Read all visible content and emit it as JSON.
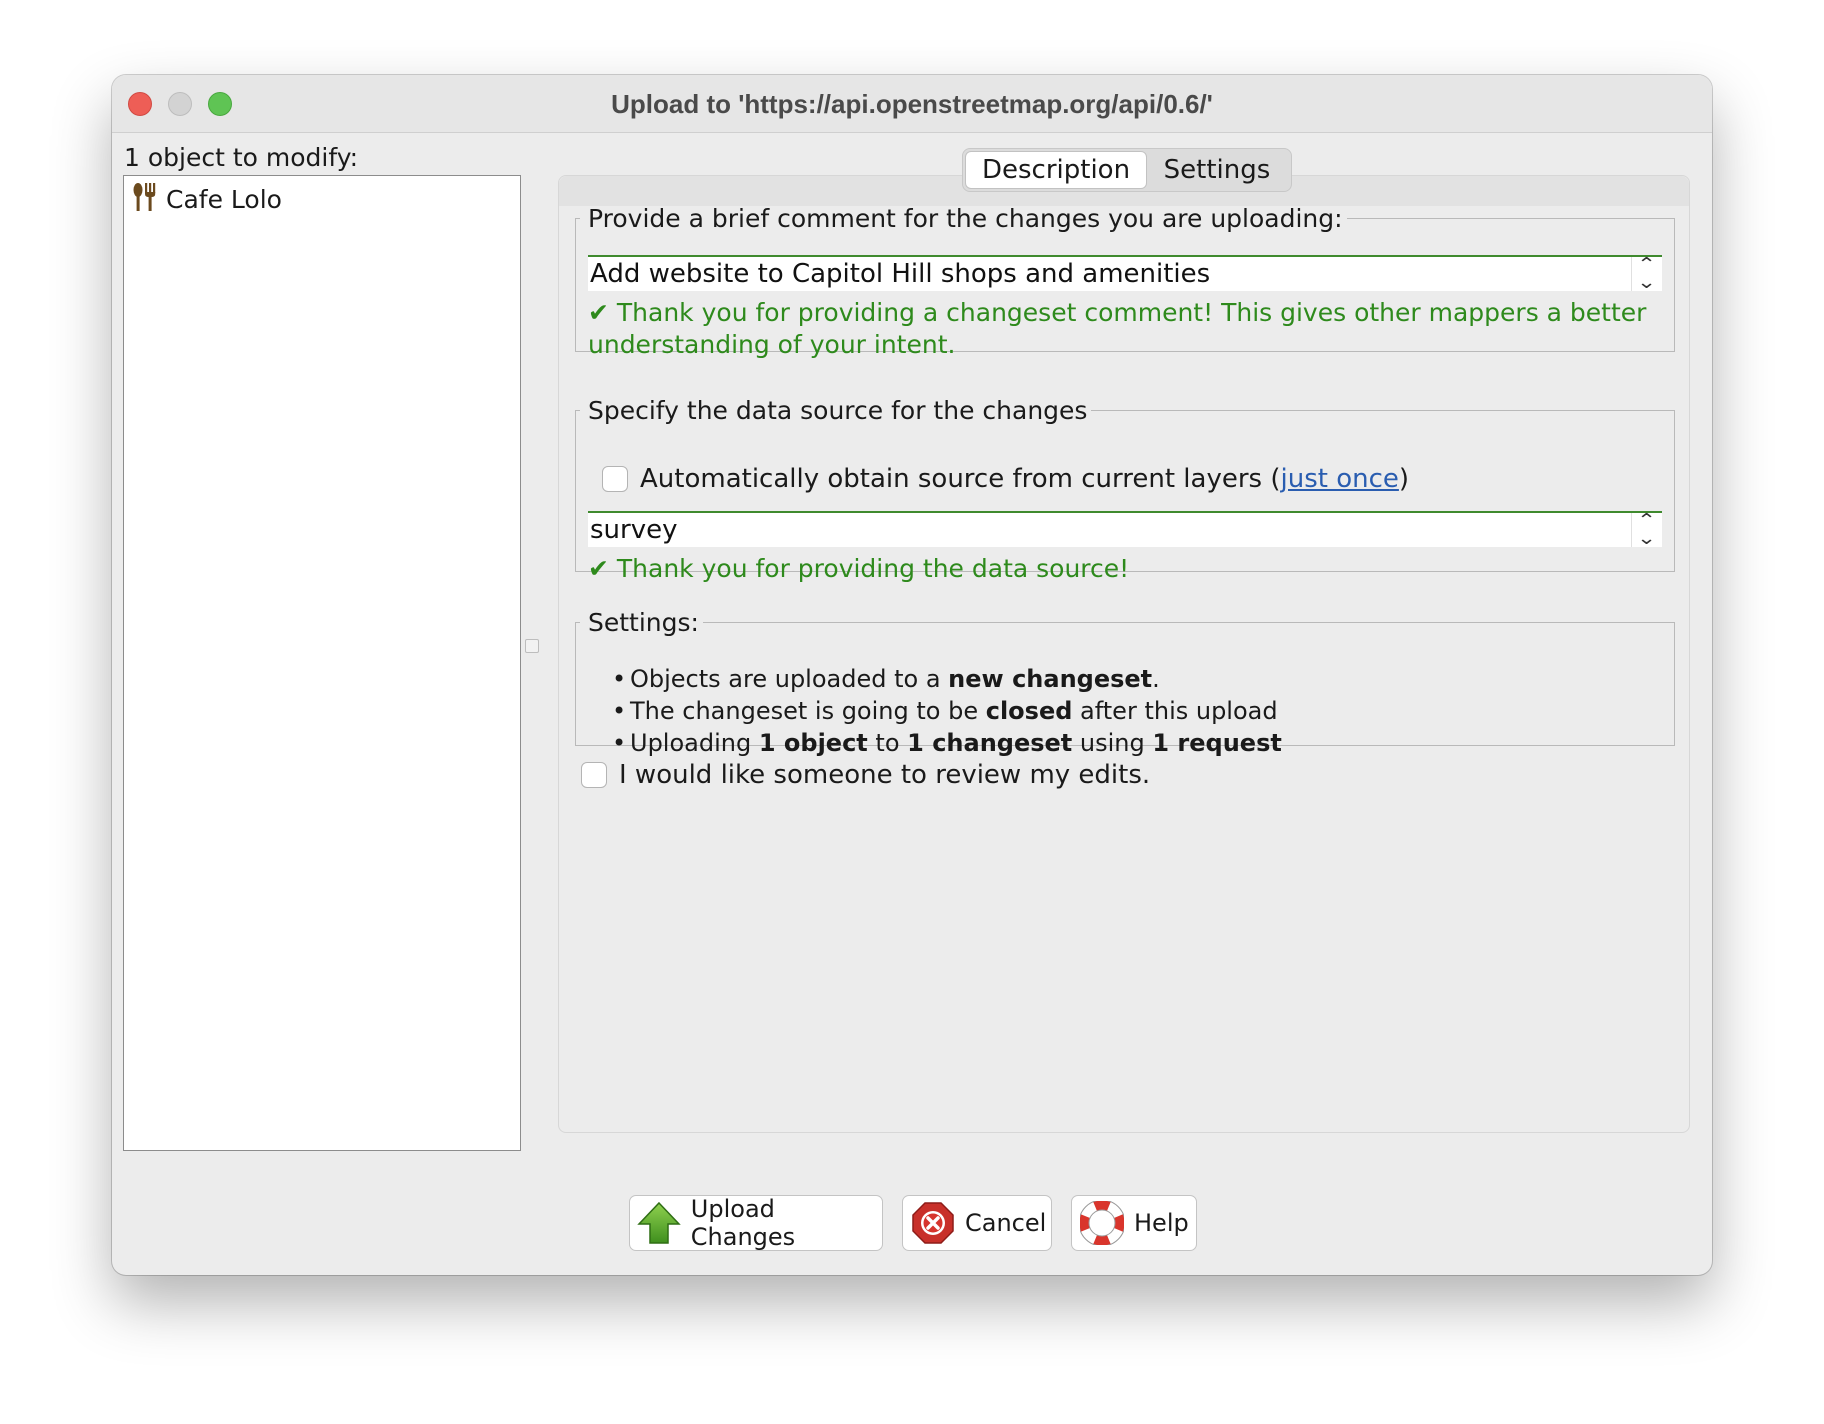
{
  "window": {
    "title": "Upload to 'https://api.openstreetmap.org/api/0.6/'"
  },
  "left_panel": {
    "header": "1 object to modify:",
    "objects": [
      {
        "label": "Cafe Lolo",
        "icon": "restaurant-icon"
      }
    ]
  },
  "tabs": [
    {
      "label": "Description",
      "active": true
    },
    {
      "label": "Settings",
      "active": false
    }
  ],
  "comment_group": {
    "legend": "Provide a brief comment for the changes you are uploading:",
    "value": "Add website to Capitol Hill shops and amenities",
    "ok_message": "✔ Thank you for providing a changeset comment! This gives other mappers a better understanding of your intent."
  },
  "source_group": {
    "legend": "Specify the data source for the changes",
    "auto_label": "Automatically obtain source from current layers",
    "auto_checked": false,
    "paren_open": "(",
    "just_once_link": "just once",
    "paren_close": ")",
    "value": "survey",
    "ok_message": "✔ Thank you for providing the data source!"
  },
  "settings_group": {
    "legend": "Settings:",
    "lines": [
      [
        "Objects are uploaded to a ",
        "new changeset",
        "."
      ],
      [
        "The changeset is going to be ",
        "closed",
        " after this upload"
      ],
      [
        "Uploading ",
        "1 object",
        " to ",
        "1 changeset",
        " using ",
        "1 request"
      ]
    ]
  },
  "review": {
    "label": "I would like someone to review my edits.",
    "checked": false
  },
  "buttons": {
    "upload": "Upload Changes",
    "cancel": "Cancel",
    "help": "Help"
  },
  "colors": {
    "ok_green": "#2e8a1c",
    "link_blue": "#2a5db0",
    "close": "#ee5e56",
    "maximize": "#5fc454"
  }
}
